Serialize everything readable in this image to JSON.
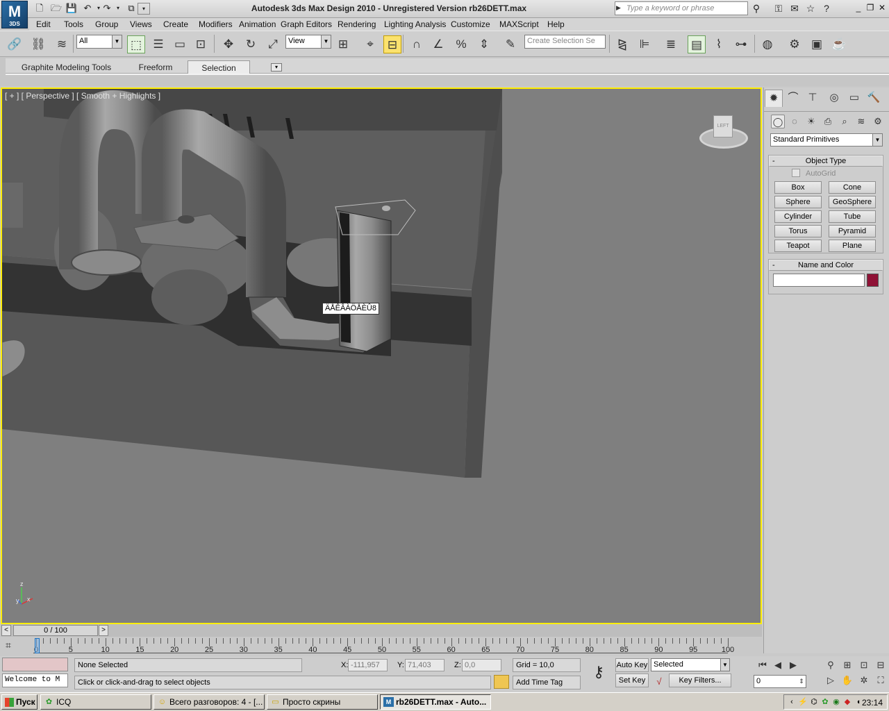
{
  "window": {
    "title": "Autodesk 3ds Max Design 2010  -  Unregistered Version     rb26DETT.max",
    "logo_text": "3DS",
    "search_placeholder": "Type a keyword or phrase"
  },
  "menu": [
    "Edit",
    "Tools",
    "Group",
    "Views",
    "Create",
    "Modifiers",
    "Animation",
    "Graph Editors",
    "Rendering",
    "Lighting Analysis",
    "Customize",
    "MAXScript",
    "Help"
  ],
  "toolbar": {
    "selection_filter": "All",
    "ref_coord": "View",
    "named_selection_placeholder": "Create Selection Se"
  },
  "ribbon": {
    "tabs": [
      {
        "label": "Graphite Modeling Tools",
        "active": false
      },
      {
        "label": "Freeform",
        "active": false
      },
      {
        "label": "Selection",
        "active": true
      }
    ]
  },
  "viewport": {
    "label": "[ + ] [ Perspective ] [ Smooth + Highlights ]",
    "object_tooltip": "ÄÅÊÂÀÖÅÈÛ8",
    "viewcube_face": "LEFT",
    "axis": {
      "x": "x",
      "y": "y",
      "z": "z"
    }
  },
  "command_panel": {
    "category": "Standard Primitives",
    "object_type_title": "Object Type",
    "autogrid_label": "AutoGrid",
    "buttons": [
      "Box",
      "Cone",
      "Sphere",
      "GeoSphere",
      "Cylinder",
      "Tube",
      "Torus",
      "Pyramid",
      "Teapot",
      "Plane"
    ],
    "name_color_title": "Name and Color",
    "object_color": "#8f1236"
  },
  "time_slider": {
    "frame_label": "0 / 100",
    "ticks": [
      "0",
      "5",
      "10",
      "15",
      "20",
      "25",
      "30",
      "35",
      "40",
      "45",
      "50",
      "55",
      "60",
      "65",
      "70",
      "75",
      "80",
      "85",
      "90",
      "95",
      "100"
    ]
  },
  "status": {
    "maxscript_text": "Welcome to M",
    "selection_status": "None Selected",
    "prompt": "Click or click-and-drag to select objects",
    "x_label": "X:",
    "x_value": "-111,957",
    "y_label": "Y:",
    "y_value": "71,403",
    "z_label": "Z:",
    "z_value": "0,0",
    "grid": "Grid = 10,0",
    "add_time_tag": "Add Time Tag",
    "auto_key": "Auto Key",
    "set_key": "Set Key",
    "key_mode": "Selected",
    "key_filters": "Key Filters...",
    "current_frame": "0"
  },
  "taskbar": {
    "start": "Пуск",
    "tasks": [
      {
        "label": "ICQ",
        "icon": "icq-flower-icon",
        "active": false
      },
      {
        "label": "Всего разговоров: 4 - [...",
        "icon": "chat-icon",
        "active": false
      },
      {
        "label": "Просто скрины",
        "icon": "folder-icon",
        "active": false
      },
      {
        "label": "rb26DETT.max - Auto...",
        "icon": "3dsmax-icon",
        "active": true
      }
    ],
    "clock": "23:14"
  }
}
